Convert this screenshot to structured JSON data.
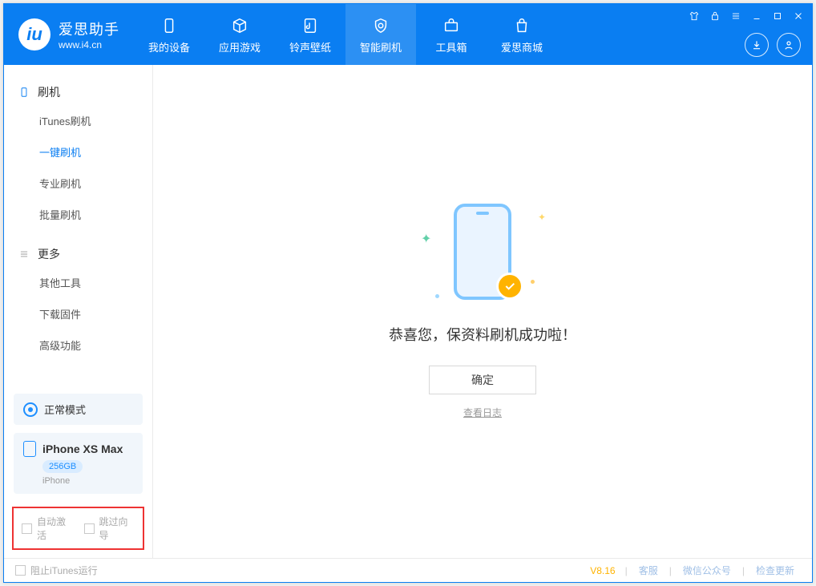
{
  "app": {
    "name_cn": "爱思助手",
    "url": "www.i4.cn"
  },
  "nav": {
    "items": [
      {
        "label": "我的设备"
      },
      {
        "label": "应用游戏"
      },
      {
        "label": "铃声壁纸"
      },
      {
        "label": "智能刷机"
      },
      {
        "label": "工具箱"
      },
      {
        "label": "爱思商城"
      }
    ]
  },
  "sidebar": {
    "group1_title": "刷机",
    "group1_items": [
      "iTunes刷机",
      "一键刷机",
      "专业刷机",
      "批量刷机"
    ],
    "group2_title": "更多",
    "group2_items": [
      "其他工具",
      "下载固件",
      "高级功能"
    ],
    "mode_label": "正常模式",
    "device_name": "iPhone XS Max",
    "device_capacity": "256GB",
    "device_type": "iPhone",
    "chk_auto_activate": "自动激活",
    "chk_skip_guide": "跳过向导"
  },
  "main": {
    "success_text": "恭喜您，保资料刷机成功啦！",
    "ok_label": "确定",
    "log_link": "查看日志"
  },
  "footer": {
    "block_itunes": "阻止iTunes运行",
    "version": "V8.16",
    "links": [
      "客服",
      "微信公众号",
      "检查更新"
    ]
  }
}
